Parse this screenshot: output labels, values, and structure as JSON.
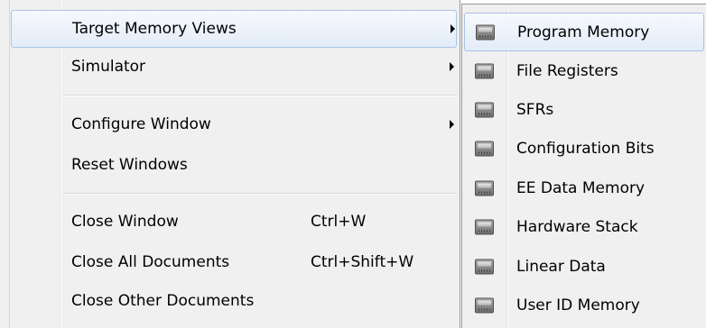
{
  "main_menu": {
    "items": [
      {
        "label": "Target Memory Views",
        "shortcut": "",
        "has_submenu": true,
        "highlighted": true
      },
      {
        "label": "Simulator",
        "shortcut": "",
        "has_submenu": true
      },
      {
        "label": "Configure Window",
        "shortcut": "",
        "has_submenu": true
      },
      {
        "label": "Reset Windows",
        "shortcut": ""
      },
      {
        "label": "Close Window",
        "shortcut": "Ctrl+W"
      },
      {
        "label": "Close All Documents",
        "shortcut": "Ctrl+Shift+W"
      },
      {
        "label": "Close Other Documents",
        "shortcut": ""
      }
    ]
  },
  "submenu": {
    "icon": "memory-chip-icon",
    "items": [
      {
        "label": "Program Memory",
        "highlighted": true
      },
      {
        "label": "File Registers"
      },
      {
        "label": "SFRs"
      },
      {
        "label": "Configuration Bits"
      },
      {
        "label": "EE Data Memory"
      },
      {
        "label": "Hardware Stack"
      },
      {
        "label": "Linear Data"
      },
      {
        "label": "User ID Memory"
      }
    ]
  },
  "colors": {
    "menu_bg": "#f0f0f0",
    "highlight_border": "#a9c3e6",
    "highlight_bg": "#e3ecf8"
  }
}
